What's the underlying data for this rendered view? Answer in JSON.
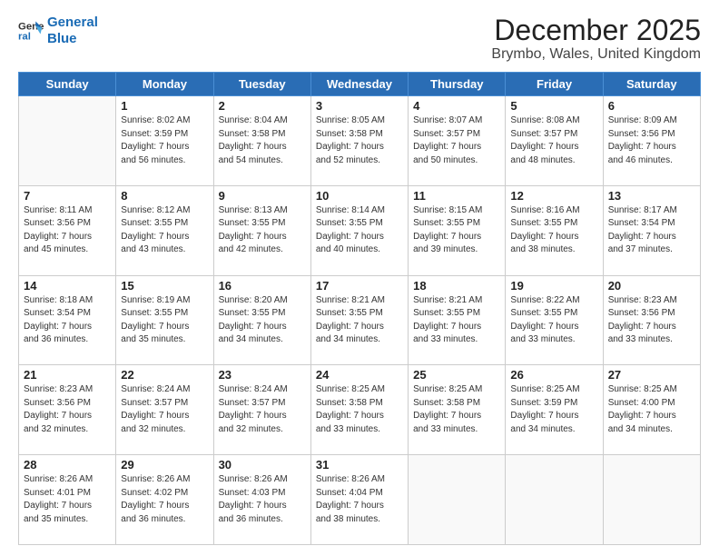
{
  "header": {
    "logo_line1": "General",
    "logo_line2": "Blue",
    "month": "December 2025",
    "location": "Brymbo, Wales, United Kingdom"
  },
  "weekdays": [
    "Sunday",
    "Monday",
    "Tuesday",
    "Wednesday",
    "Thursday",
    "Friday",
    "Saturday"
  ],
  "weeks": [
    [
      {
        "day": "",
        "info": ""
      },
      {
        "day": "1",
        "info": "Sunrise: 8:02 AM\nSunset: 3:59 PM\nDaylight: 7 hours\nand 56 minutes."
      },
      {
        "day": "2",
        "info": "Sunrise: 8:04 AM\nSunset: 3:58 PM\nDaylight: 7 hours\nand 54 minutes."
      },
      {
        "day": "3",
        "info": "Sunrise: 8:05 AM\nSunset: 3:58 PM\nDaylight: 7 hours\nand 52 minutes."
      },
      {
        "day": "4",
        "info": "Sunrise: 8:07 AM\nSunset: 3:57 PM\nDaylight: 7 hours\nand 50 minutes."
      },
      {
        "day": "5",
        "info": "Sunrise: 8:08 AM\nSunset: 3:57 PM\nDaylight: 7 hours\nand 48 minutes."
      },
      {
        "day": "6",
        "info": "Sunrise: 8:09 AM\nSunset: 3:56 PM\nDaylight: 7 hours\nand 46 minutes."
      }
    ],
    [
      {
        "day": "7",
        "info": "Sunrise: 8:11 AM\nSunset: 3:56 PM\nDaylight: 7 hours\nand 45 minutes."
      },
      {
        "day": "8",
        "info": "Sunrise: 8:12 AM\nSunset: 3:55 PM\nDaylight: 7 hours\nand 43 minutes."
      },
      {
        "day": "9",
        "info": "Sunrise: 8:13 AM\nSunset: 3:55 PM\nDaylight: 7 hours\nand 42 minutes."
      },
      {
        "day": "10",
        "info": "Sunrise: 8:14 AM\nSunset: 3:55 PM\nDaylight: 7 hours\nand 40 minutes."
      },
      {
        "day": "11",
        "info": "Sunrise: 8:15 AM\nSunset: 3:55 PM\nDaylight: 7 hours\nand 39 minutes."
      },
      {
        "day": "12",
        "info": "Sunrise: 8:16 AM\nSunset: 3:55 PM\nDaylight: 7 hours\nand 38 minutes."
      },
      {
        "day": "13",
        "info": "Sunrise: 8:17 AM\nSunset: 3:54 PM\nDaylight: 7 hours\nand 37 minutes."
      }
    ],
    [
      {
        "day": "14",
        "info": "Sunrise: 8:18 AM\nSunset: 3:54 PM\nDaylight: 7 hours\nand 36 minutes."
      },
      {
        "day": "15",
        "info": "Sunrise: 8:19 AM\nSunset: 3:55 PM\nDaylight: 7 hours\nand 35 minutes."
      },
      {
        "day": "16",
        "info": "Sunrise: 8:20 AM\nSunset: 3:55 PM\nDaylight: 7 hours\nand 34 minutes."
      },
      {
        "day": "17",
        "info": "Sunrise: 8:21 AM\nSunset: 3:55 PM\nDaylight: 7 hours\nand 34 minutes."
      },
      {
        "day": "18",
        "info": "Sunrise: 8:21 AM\nSunset: 3:55 PM\nDaylight: 7 hours\nand 33 minutes."
      },
      {
        "day": "19",
        "info": "Sunrise: 8:22 AM\nSunset: 3:55 PM\nDaylight: 7 hours\nand 33 minutes."
      },
      {
        "day": "20",
        "info": "Sunrise: 8:23 AM\nSunset: 3:56 PM\nDaylight: 7 hours\nand 33 minutes."
      }
    ],
    [
      {
        "day": "21",
        "info": "Sunrise: 8:23 AM\nSunset: 3:56 PM\nDaylight: 7 hours\nand 32 minutes."
      },
      {
        "day": "22",
        "info": "Sunrise: 8:24 AM\nSunset: 3:57 PM\nDaylight: 7 hours\nand 32 minutes."
      },
      {
        "day": "23",
        "info": "Sunrise: 8:24 AM\nSunset: 3:57 PM\nDaylight: 7 hours\nand 32 minutes."
      },
      {
        "day": "24",
        "info": "Sunrise: 8:25 AM\nSunset: 3:58 PM\nDaylight: 7 hours\nand 33 minutes."
      },
      {
        "day": "25",
        "info": "Sunrise: 8:25 AM\nSunset: 3:58 PM\nDaylight: 7 hours\nand 33 minutes."
      },
      {
        "day": "26",
        "info": "Sunrise: 8:25 AM\nSunset: 3:59 PM\nDaylight: 7 hours\nand 34 minutes."
      },
      {
        "day": "27",
        "info": "Sunrise: 8:25 AM\nSunset: 4:00 PM\nDaylight: 7 hours\nand 34 minutes."
      }
    ],
    [
      {
        "day": "28",
        "info": "Sunrise: 8:26 AM\nSunset: 4:01 PM\nDaylight: 7 hours\nand 35 minutes."
      },
      {
        "day": "29",
        "info": "Sunrise: 8:26 AM\nSunset: 4:02 PM\nDaylight: 7 hours\nand 36 minutes."
      },
      {
        "day": "30",
        "info": "Sunrise: 8:26 AM\nSunset: 4:03 PM\nDaylight: 7 hours\nand 36 minutes."
      },
      {
        "day": "31",
        "info": "Sunrise: 8:26 AM\nSunset: 4:04 PM\nDaylight: 7 hours\nand 38 minutes."
      },
      {
        "day": "",
        "info": ""
      },
      {
        "day": "",
        "info": ""
      },
      {
        "day": "",
        "info": ""
      }
    ]
  ]
}
